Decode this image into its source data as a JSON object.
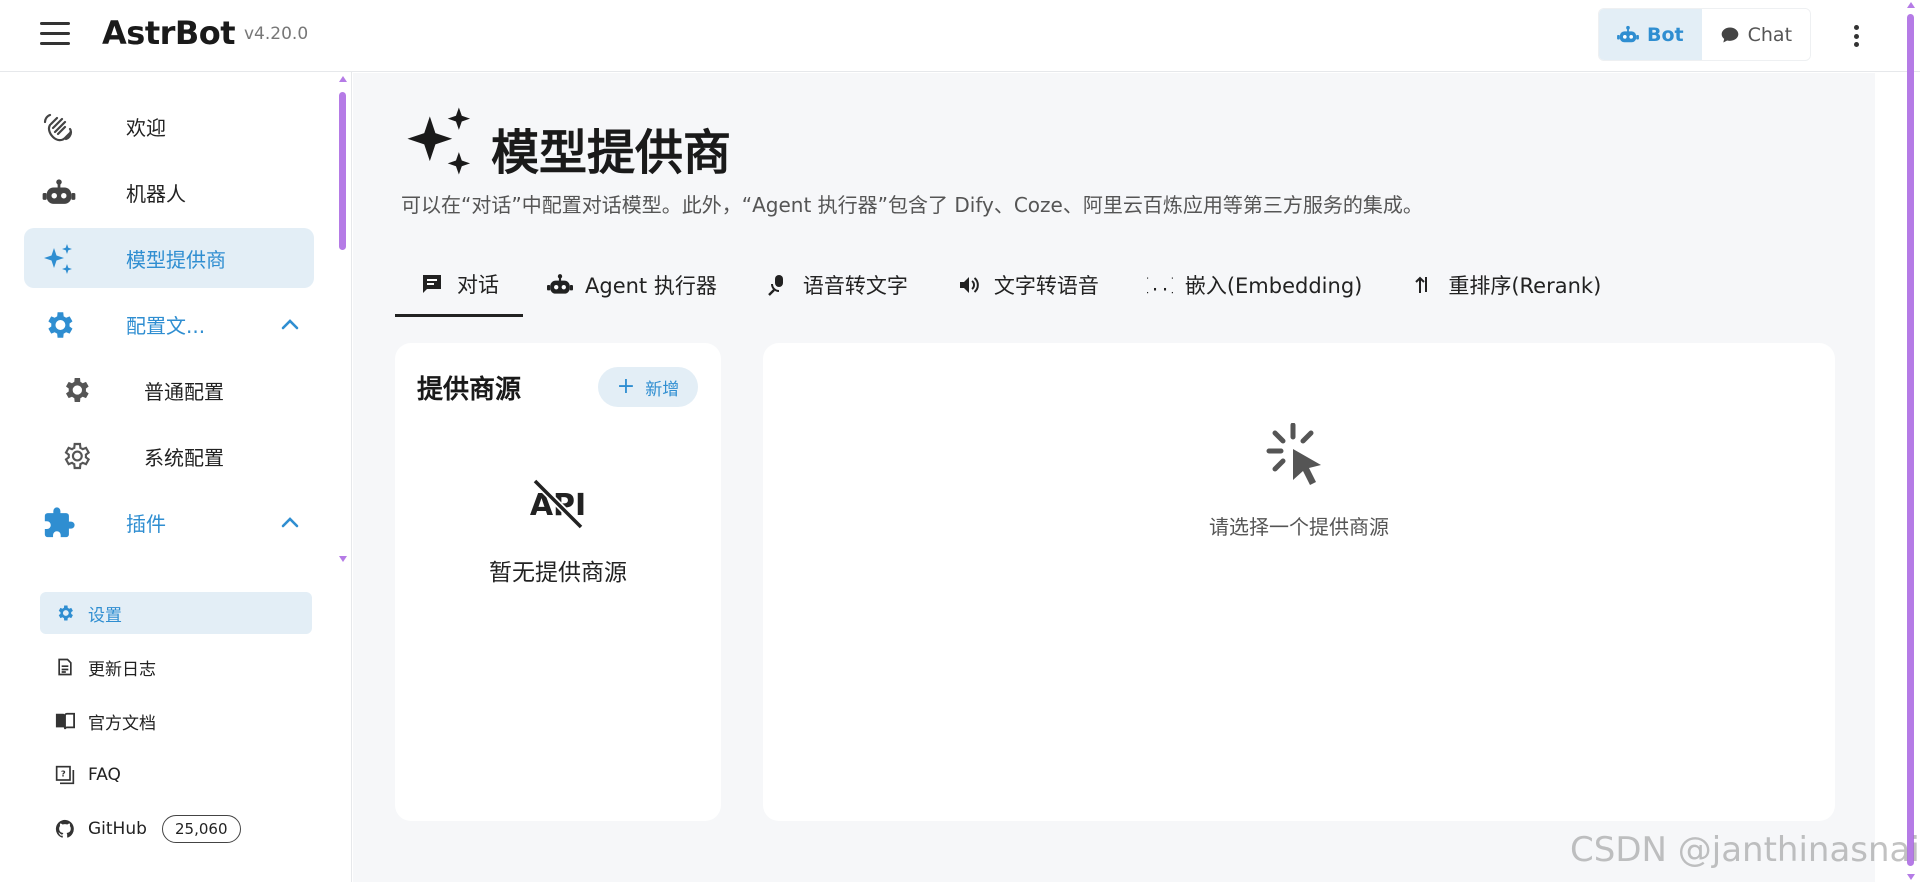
{
  "app": {
    "name": "AstrBot",
    "version": "v4.20.0"
  },
  "header": {
    "modes": [
      {
        "label": "Bot",
        "active": true,
        "icon": "robot-icon"
      },
      {
        "label": "Chat",
        "active": false,
        "icon": "chat-bubble-icon"
      }
    ]
  },
  "sidebar": {
    "items": [
      {
        "label": "欢迎",
        "icon": "waving-hand-icon"
      },
      {
        "label": "机器人",
        "icon": "robot-icon"
      },
      {
        "label": "模型提供商",
        "icon": "sparkles-icon",
        "active": true
      },
      {
        "label": "配置文...",
        "icon": "gear-icon",
        "expanded": true
      },
      {
        "label": "普通配置",
        "icon": "gear-icon"
      },
      {
        "label": "系统配置",
        "icon": "gear-outline-icon"
      },
      {
        "label": "插件",
        "icon": "puzzle-icon",
        "expanded": true
      }
    ],
    "footer": [
      {
        "label": "设置",
        "icon": "gear-icon",
        "active": true
      },
      {
        "label": "更新日志",
        "icon": "document-icon"
      },
      {
        "label": "官方文档",
        "icon": "book-icon"
      },
      {
        "label": "FAQ",
        "icon": "faq-icon"
      },
      {
        "label": "GitHub",
        "icon": "github-icon",
        "badge": "25,060"
      }
    ]
  },
  "main": {
    "title": "模型提供商",
    "subtitle": "可以在“对话”中配置对话模型。此外，“Agent 执行器”包含了 Dify、Coze、阿里云百炼应用等第三方服务的集成。",
    "tabs": [
      {
        "label": "对话",
        "icon": "chat-square-icon",
        "active": true
      },
      {
        "label": "Agent 执行器",
        "icon": "robot-icon"
      },
      {
        "label": "语音转文字",
        "icon": "microphone-icon"
      },
      {
        "label": "文字转语音",
        "icon": "speaker-icon"
      },
      {
        "label": "嵌入(Embedding)",
        "icon": "curly-braces-icon"
      },
      {
        "label": "重排序(Rerank)",
        "icon": "sort-arrows-icon"
      }
    ],
    "provider_card": {
      "title": "提供商源",
      "add_label": "新增",
      "empty_text": "暂无提供商源"
    },
    "detail_card": {
      "hint": "请选择一个提供商源"
    }
  },
  "watermark": "CSDN @janthinasnail",
  "colors": {
    "accent": "#2f8ed1",
    "accent_bg": "#e3eef6",
    "scrollbar": "#b57be6"
  }
}
